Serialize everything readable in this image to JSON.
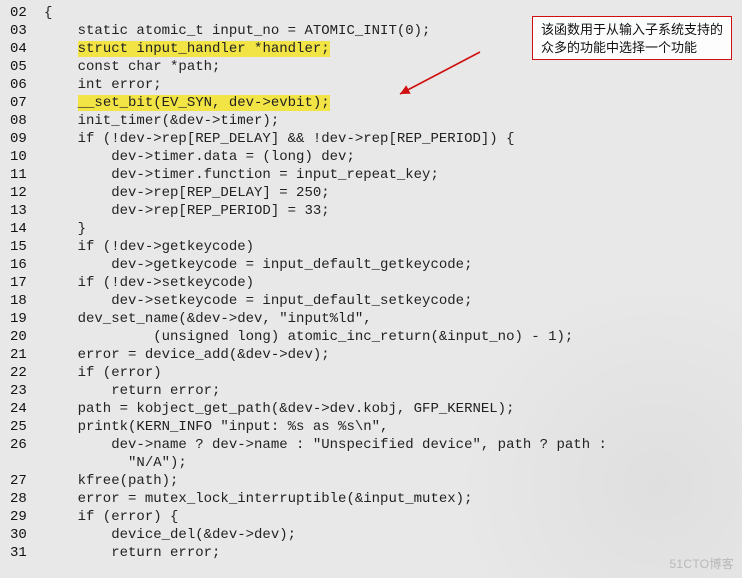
{
  "annotation": {
    "line1": "该函数用于从输入子系统支持的",
    "line2": "众多的功能中选择一个功能"
  },
  "watermark": "51CTO博客",
  "lines": [
    {
      "n": "02",
      "code": "{"
    },
    {
      "n": "03",
      "code": "    static atomic_t input_no = ATOMIC_INIT(0);"
    },
    {
      "n": "04",
      "code": "    ",
      "hlPrefix": "",
      "hl": "struct input_handler *handler;"
    },
    {
      "n": "05",
      "code": "    const char *path;"
    },
    {
      "n": "06",
      "code": "    int error;"
    },
    {
      "n": "07",
      "code": "    ",
      "hl": "__set_bit(EV_SYN, dev->evbit);"
    },
    {
      "n": "08",
      "code": "    init_timer(&dev->timer);"
    },
    {
      "n": "09",
      "code": "    if (!dev->rep[REP_DELAY] && !dev->rep[REP_PERIOD]) {"
    },
    {
      "n": "10",
      "code": "        dev->timer.data = (long) dev;"
    },
    {
      "n": "11",
      "code": "        dev->timer.function = input_repeat_key;"
    },
    {
      "n": "12",
      "code": "        dev->rep[REP_DELAY] = 250;"
    },
    {
      "n": "13",
      "code": "        dev->rep[REP_PERIOD] = 33;"
    },
    {
      "n": "14",
      "code": "    }"
    },
    {
      "n": "15",
      "code": "    if (!dev->getkeycode)"
    },
    {
      "n": "16",
      "code": "        dev->getkeycode = input_default_getkeycode;"
    },
    {
      "n": "17",
      "code": "    if (!dev->setkeycode)"
    },
    {
      "n": "18",
      "code": "        dev->setkeycode = input_default_setkeycode;"
    },
    {
      "n": "19",
      "code": "    dev_set_name(&dev->dev, \"input%ld\","
    },
    {
      "n": "20",
      "code": "             (unsigned long) atomic_inc_return(&input_no) - 1);"
    },
    {
      "n": "21",
      "code": "    error = device_add(&dev->dev);"
    },
    {
      "n": "22",
      "code": "    if (error)"
    },
    {
      "n": "23",
      "code": "        return error;"
    },
    {
      "n": "24",
      "code": "    path = kobject_get_path(&dev->dev.kobj, GFP_KERNEL);"
    },
    {
      "n": "25",
      "code": "    printk(KERN_INFO \"input: %s as %s\\n\","
    },
    {
      "n": "26",
      "code": "        dev->name ? dev->name : \"Unspecified device\", path ? path :"
    },
    {
      "n": "",
      "code": "          \"N/A\");"
    },
    {
      "n": "27",
      "code": "    kfree(path);"
    },
    {
      "n": "28",
      "code": "    error = mutex_lock_interruptible(&input_mutex);"
    },
    {
      "n": "29",
      "code": "    if (error) {"
    },
    {
      "n": "30",
      "code": "        device_del(&dev->dev);"
    },
    {
      "n": "31",
      "code": "        return error;"
    }
  ]
}
